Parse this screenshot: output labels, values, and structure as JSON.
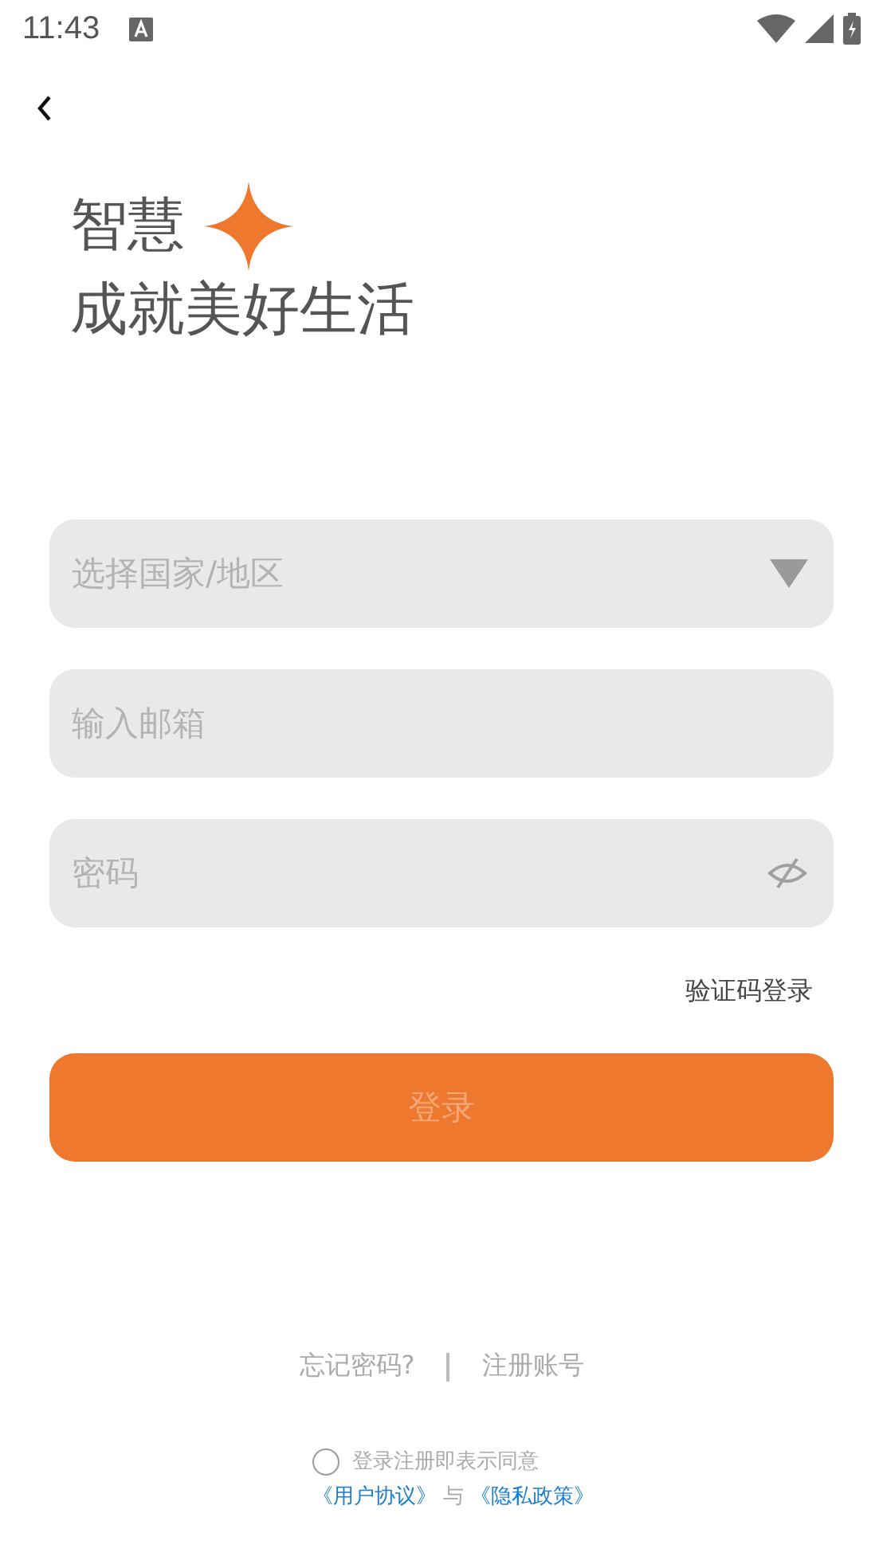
{
  "status_bar": {
    "time": "11:43"
  },
  "headline": {
    "line_1": "智慧",
    "line_2": "成就美好生活"
  },
  "form": {
    "country": {
      "placeholder": "选择国家/地区"
    },
    "email": {
      "placeholder": "输入邮箱"
    },
    "password": {
      "placeholder": "密码",
      "visible": false
    }
  },
  "code_login_link": "验证码登录",
  "login_button": {
    "label": "登录",
    "disabled": true
  },
  "links": {
    "forgot": "忘记密码?",
    "register": "注册账号"
  },
  "agreement": {
    "checked": false,
    "text": "登录注册即表示同意",
    "user_agreement": "《用户协议》",
    "joiner": "与",
    "privacy_policy": "《隐私政策》"
  }
}
